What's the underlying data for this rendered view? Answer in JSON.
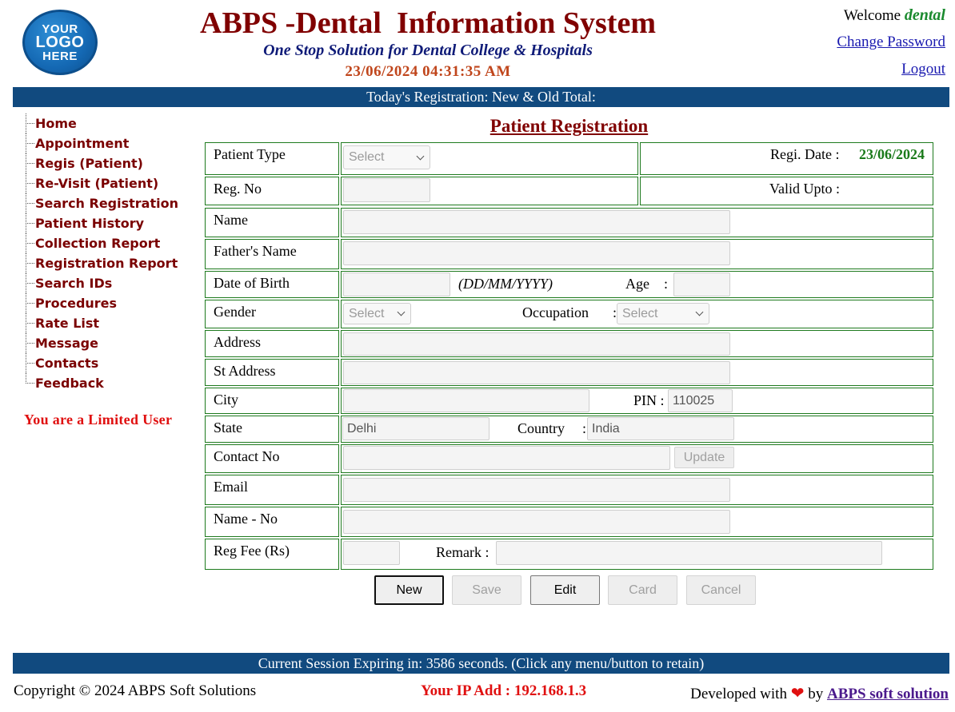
{
  "logo": {
    "line1": "YOUR",
    "line2": "LOGO",
    "line3": "HERE"
  },
  "header": {
    "title": "ABPS -Dental  Information System",
    "subtitle": "One Stop Solution for Dental College & Hospitals",
    "datetime": "23/06/2024 04:31:35 AM",
    "welcome_label": "Welcome",
    "username": "dental",
    "change_password": "Change Password",
    "logout": "Logout"
  },
  "registration_bar": "Today's Registration: New  & Old  Total:",
  "menu": {
    "items": [
      "Home",
      "Appointment",
      "Regis (Patient)",
      "Re-Visit (Patient)",
      "Search Registration",
      "Patient History",
      "Collection Report",
      "Registration Report",
      "Search IDs",
      "Procedures",
      "Rate List",
      "Message",
      "Contacts",
      "Feedback"
    ],
    "user_notice": "You are a Limited User"
  },
  "form": {
    "title": "Patient Registration",
    "patient_type": {
      "label": "Patient Type",
      "value": "Select"
    },
    "regi_date": {
      "label": "Regi. Date :",
      "value": "23/06/2024"
    },
    "reg_no": {
      "label": "Reg. No",
      "value": ""
    },
    "valid_upto": {
      "label": "Valid Upto :",
      "value": ""
    },
    "name": {
      "label": "Name",
      "value": ""
    },
    "fathers_name": {
      "label": "Father's Name",
      "value": ""
    },
    "dob": {
      "label": "Date of Birth",
      "value": "",
      "hint": "(DD/MM/YYYY)"
    },
    "age": {
      "label": "Age",
      "sep": ":",
      "value": ""
    },
    "gender": {
      "label": "Gender",
      "value": "Select"
    },
    "occupation": {
      "label": "Occupation",
      "sep": ":",
      "value": "Select"
    },
    "address": {
      "label": "Address",
      "value": ""
    },
    "st_address": {
      "label": "St Address",
      "value": ""
    },
    "city": {
      "label": "City",
      "value": ""
    },
    "pin": {
      "label": "PIN :",
      "value": "110025"
    },
    "state": {
      "label": "State",
      "value": "Delhi"
    },
    "country": {
      "label": "Country",
      "sep": ":",
      "value": "India"
    },
    "contact_no": {
      "label": "Contact No",
      "value": ""
    },
    "update_button": "Update",
    "email": {
      "label": "Email",
      "value": ""
    },
    "name_no": {
      "label": "Name - No",
      "value": ""
    },
    "reg_fee": {
      "label": "Reg Fee (Rs)",
      "value": ""
    },
    "remark": {
      "label": "Remark :",
      "value": ""
    }
  },
  "buttons": {
    "new": "New",
    "save": "Save",
    "edit": "Edit",
    "card": "Card",
    "cancel": "Cancel"
  },
  "session_bar": "Current Session Expiring in: 3586 seconds. (Click any menu/button to retain)",
  "footer": {
    "copyright": "Copyright © 2024 ABPS Soft Solutions",
    "ip": "Your IP Add : 192.168.1.3",
    "developed_prefix": "Developed with",
    "heart": "❤",
    "by": "by",
    "developer": "ABPS soft solution"
  },
  "colors": {
    "brand_red": "#800000",
    "bar_blue": "#114a7f",
    "table_border": "#1e7a1e",
    "accent_green": "#1a8a2e"
  }
}
